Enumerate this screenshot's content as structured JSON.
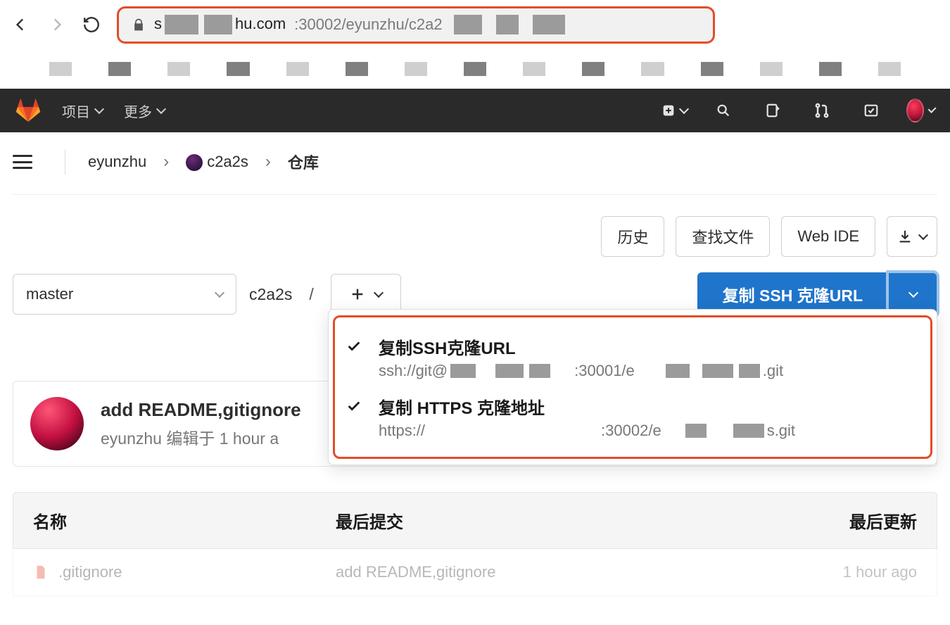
{
  "browser": {
    "url_host_partial": "hu.com",
    "url_port_path": ":30002/eyunzhu/c2a2"
  },
  "navbar": {
    "projects": "项目",
    "more": "更多"
  },
  "breadcrumb": {
    "group": "eyunzhu",
    "project": "c2a2s",
    "section": "仓库"
  },
  "actions": {
    "history": "历史",
    "find_file": "查找文件",
    "web_ide": "Web IDE"
  },
  "branch": {
    "selected": "master"
  },
  "path": {
    "root": "c2a2s",
    "sep": "/"
  },
  "clone": {
    "button": "复制 SSH 克隆URL",
    "options": [
      {
        "title": "复制SSH克隆URL",
        "prefix": "ssh://git@",
        "mid": ":30001/e",
        "suffix": ".git"
      },
      {
        "title": "复制 HTTPS 克隆地址",
        "prefix": "https://",
        "mid": ":30002/e",
        "suffix": "s.git"
      }
    ]
  },
  "commit": {
    "title": "add README,gitignore",
    "author": "eyunzhu",
    "edited_prefix": "编辑于",
    "time": "1 hour a"
  },
  "table": {
    "col_name": "名称",
    "col_last_commit": "最后提交",
    "col_last_update": "最后更新",
    "rows": [
      {
        "name": ".gitignore",
        "commit": "add README,gitignore",
        "time": "1 hour ago"
      }
    ]
  }
}
